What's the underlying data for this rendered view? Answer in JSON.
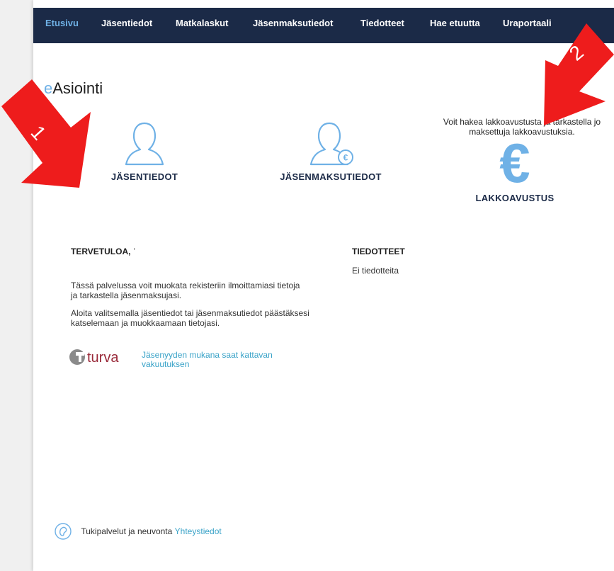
{
  "nav": {
    "items": [
      {
        "label": "Etusivu",
        "active": true
      },
      {
        "label": "Jäsentiedot"
      },
      {
        "label": "Matkalaskut"
      },
      {
        "label": "Jäsenmaksutiedot"
      },
      {
        "label": "Tiedotteet"
      },
      {
        "label": "Hae etuutta"
      },
      {
        "label": "Uraportaali"
      }
    ]
  },
  "brand": {
    "prefix": "e",
    "name": "Asiointi"
  },
  "tiles": {
    "member_info": "JÄSENTIEDOT",
    "member_fees": "JÄSENMAKSUTIEDOT",
    "strike": "LAKKOAVUSTUS",
    "strike_desc": "Voit hakea lakkoavustusta ja tarkastella jo maksettuja lakkoavustuksia.",
    "euro_symbol": "€",
    "fee_badge": "€"
  },
  "welcome": {
    "title": "TERVETULOA, ˈ",
    "p1": "Tässä palvelussa voit muokata rekisteriin ilmoittamiasi tietoja ja tarkastella jäsenmaksujasi.",
    "p2": "Aloita valitsemalla jäsentiedot tai jäsenmaksutiedot päästäksesi katselemaan ja muokkaamaan tietojasi."
  },
  "turva": {
    "logo_text": "turva",
    "link": "Jäsenyyden mukana saat kattavan vakuutuksen"
  },
  "news": {
    "title": "TIEDOTTEET",
    "empty": "Ei tiedotteita"
  },
  "support": {
    "text": "Tukipalvelut ja neuvonta",
    "link": "Yhteystiedot"
  },
  "annotations": {
    "arrow1": "1",
    "arrow2": "2"
  },
  "colors": {
    "nav_bg": "#1b2a47",
    "accent": "#6fb1e6",
    "link": "#3aa3c8",
    "arrow": "#ee1c1c"
  }
}
